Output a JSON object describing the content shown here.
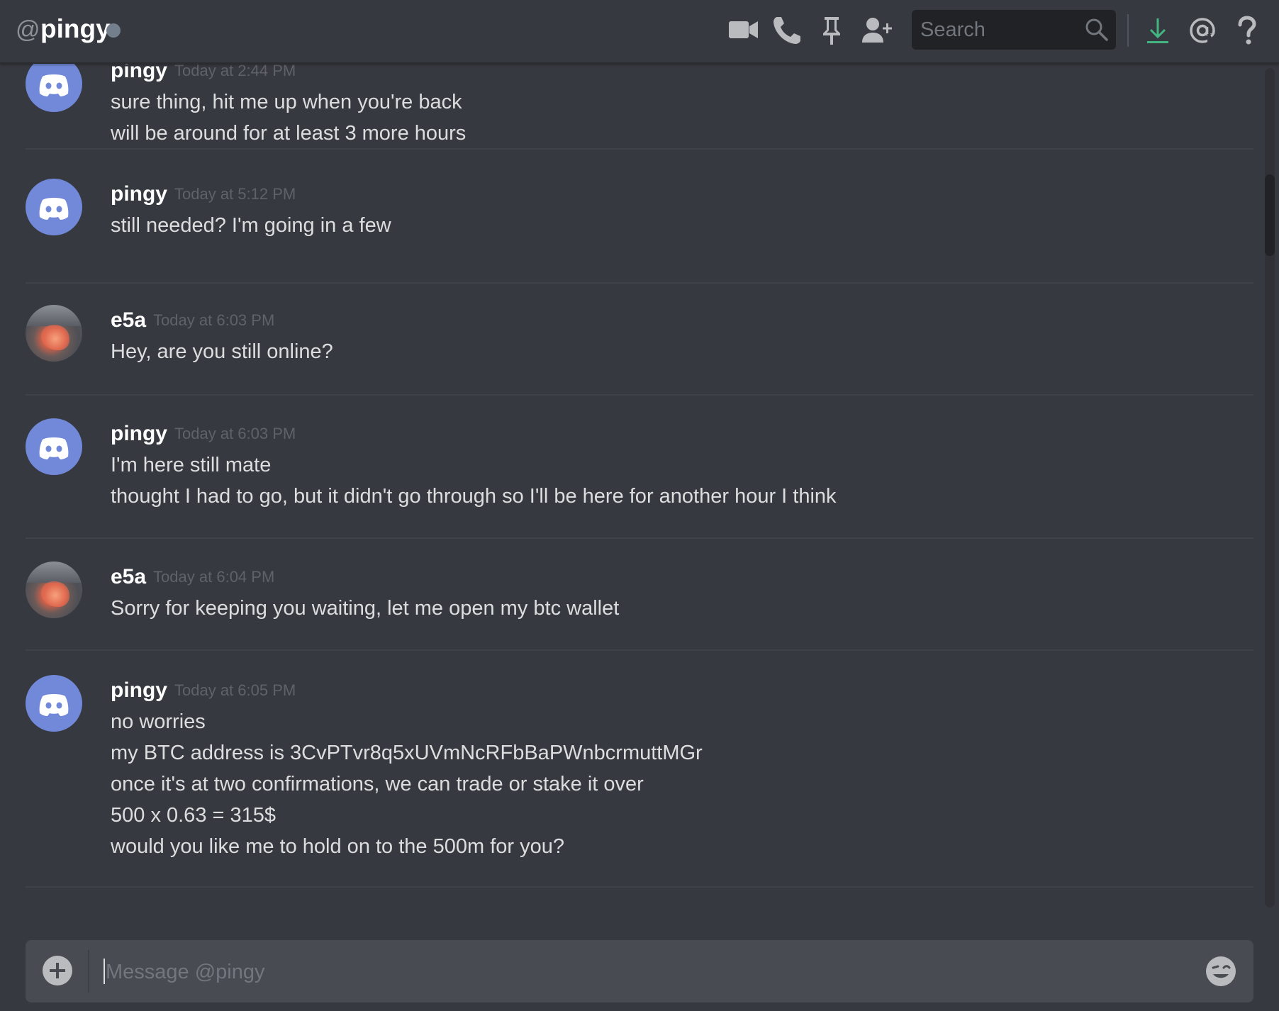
{
  "header": {
    "at_symbol": "@",
    "channel_name": "pingy",
    "status": "offline",
    "search_placeholder": "Search",
    "icons": [
      "video-call-icon",
      "voice-call-icon",
      "pin-icon",
      "add-friend-icon",
      "search-icon",
      "download-icon",
      "mention-icon",
      "help-icon"
    ]
  },
  "messages": [
    {
      "author": "pingy",
      "avatar": "discord-default",
      "time": "Today at 2:44 PM",
      "lines": [
        "sure thing, hit me up when you're back",
        "will be around for at least 3 more hours"
      ]
    },
    {
      "author": "pingy",
      "avatar": "discord-default",
      "time": "Today at 5:12 PM",
      "lines": [
        "still needed? I'm going in a few"
      ]
    },
    {
      "author": "e5a",
      "avatar": "photo",
      "time": "Today at 6:03 PM",
      "lines": [
        "Hey, are you still online?"
      ]
    },
    {
      "author": "pingy",
      "avatar": "discord-default",
      "time": "Today at 6:03 PM",
      "lines": [
        "I'm here still mate",
        "thought I had to go, but it didn't go through so I'll be here for another hour I think"
      ]
    },
    {
      "author": "e5a",
      "avatar": "photo",
      "time": "Today at 6:04 PM",
      "lines": [
        "Sorry for keeping you waiting, let me open my btc wallet"
      ]
    },
    {
      "author": "pingy",
      "avatar": "discord-default",
      "time": "Today at 6:05 PM",
      "lines": [
        "no worries",
        "my BTC address is 3CvPTvr8q5xUVmNcRFbBaPWnbcrmuttMGr",
        "once it's at two confirmations, we can trade or stake it over",
        "500 x 0.63 = 315$",
        "would you like me to hold on to the 500m for you?"
      ]
    }
  ],
  "composer": {
    "placeholder": "Message @pingy",
    "value": ""
  },
  "colors": {
    "background": "#36393f",
    "header_bg": "#36393f",
    "accent_blurple": "#7289da",
    "download_green": "#43b581",
    "text": "#dcddde",
    "muted": "#72767d"
  }
}
